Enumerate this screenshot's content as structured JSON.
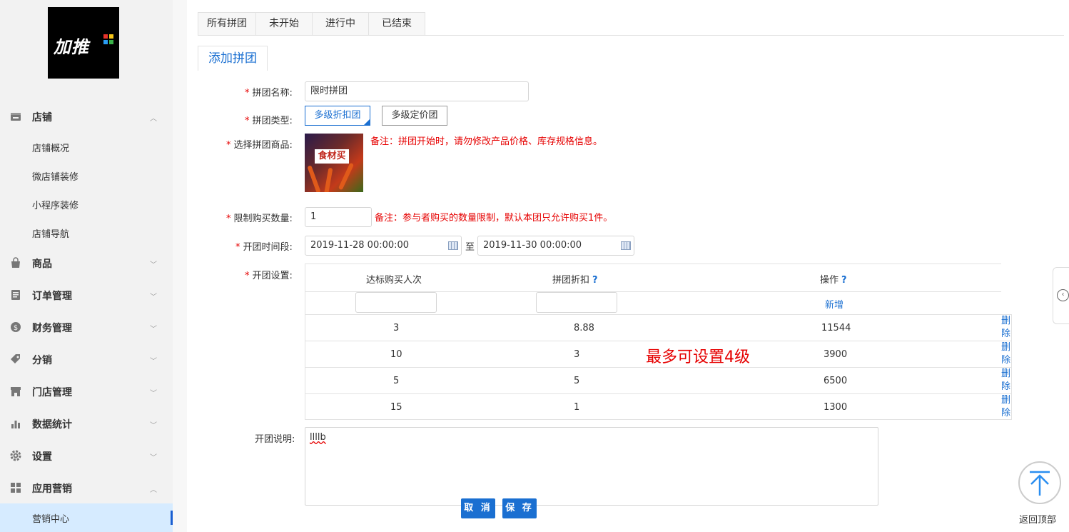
{
  "app": {
    "logo_text": "加推",
    "colors": {
      "accent": "#1a6fd1",
      "warning": "#e60000",
      "sidebar_bg": "#f2f2f2",
      "active_bg": "#d6ebff"
    }
  },
  "sidebar": {
    "groups": [
      {
        "label": "店铺",
        "icon": "store-icon",
        "expanded": true
      },
      {
        "label": "商品",
        "icon": "bag-icon",
        "expanded": false
      },
      {
        "label": "订单管理",
        "icon": "order-icon",
        "expanded": false
      },
      {
        "label": "财务管理",
        "icon": "finance-icon",
        "expanded": false
      },
      {
        "label": "分销",
        "icon": "tag-icon",
        "expanded": false
      },
      {
        "label": "门店管理",
        "icon": "shop-icon",
        "expanded": false
      },
      {
        "label": "数据统计",
        "icon": "chart-icon",
        "expanded": false
      },
      {
        "label": "设置",
        "icon": "gear-icon",
        "expanded": false
      },
      {
        "label": "应用营销",
        "icon": "apps-icon",
        "expanded": true
      }
    ],
    "store_items": [
      "店铺概况",
      "微店铺装修",
      "小程序装修",
      "店铺导航"
    ],
    "marketing_items": [
      "营销中心"
    ]
  },
  "tabs": [
    "所有拼团",
    "未开始",
    "进行中",
    "已结束"
  ],
  "subtab": "添加拼团",
  "form": {
    "name": {
      "label": "拼团名称:",
      "value": "限时拼团"
    },
    "type": {
      "label": "拼团类型:",
      "options": [
        "多级折扣团",
        "多级定价团"
      ],
      "selected": "多级折扣团"
    },
    "product": {
      "label": "选择拼团商品:",
      "note": "备注：拼团开始时，请勿修改产品价格、库存规格信息。",
      "image_text": "食材买"
    },
    "limit": {
      "label": "限制购买数量:",
      "value": "1",
      "note": "备注：参与者购买的数量限制，默认本团只允许购买1件。"
    },
    "period": {
      "label": "开团时间段:",
      "start": "2019-11-28 00:00:00",
      "to": "至",
      "end": "2019-11-30 00:00:00"
    },
    "settings": {
      "label": "开团设置:",
      "columns": [
        "达标购买人次",
        "拼团折扣",
        "操作"
      ],
      "help": "?",
      "add_label": "新增",
      "delete_label": "删除",
      "rows": [
        {
          "people": "3",
          "discount": "8.88",
          "op": "11544"
        },
        {
          "people": "10",
          "discount": "3",
          "op": "3900"
        },
        {
          "people": "5",
          "discount": "5",
          "op": "6500"
        },
        {
          "people": "15",
          "discount": "1",
          "op": "1300"
        }
      ],
      "overlay_note": "最多可设置4级"
    },
    "description": {
      "label": "开团说明:",
      "value": "llllb"
    }
  },
  "actions": {
    "cancel": "取 消",
    "save": "保 存"
  },
  "back_to_top": "返回顶部"
}
